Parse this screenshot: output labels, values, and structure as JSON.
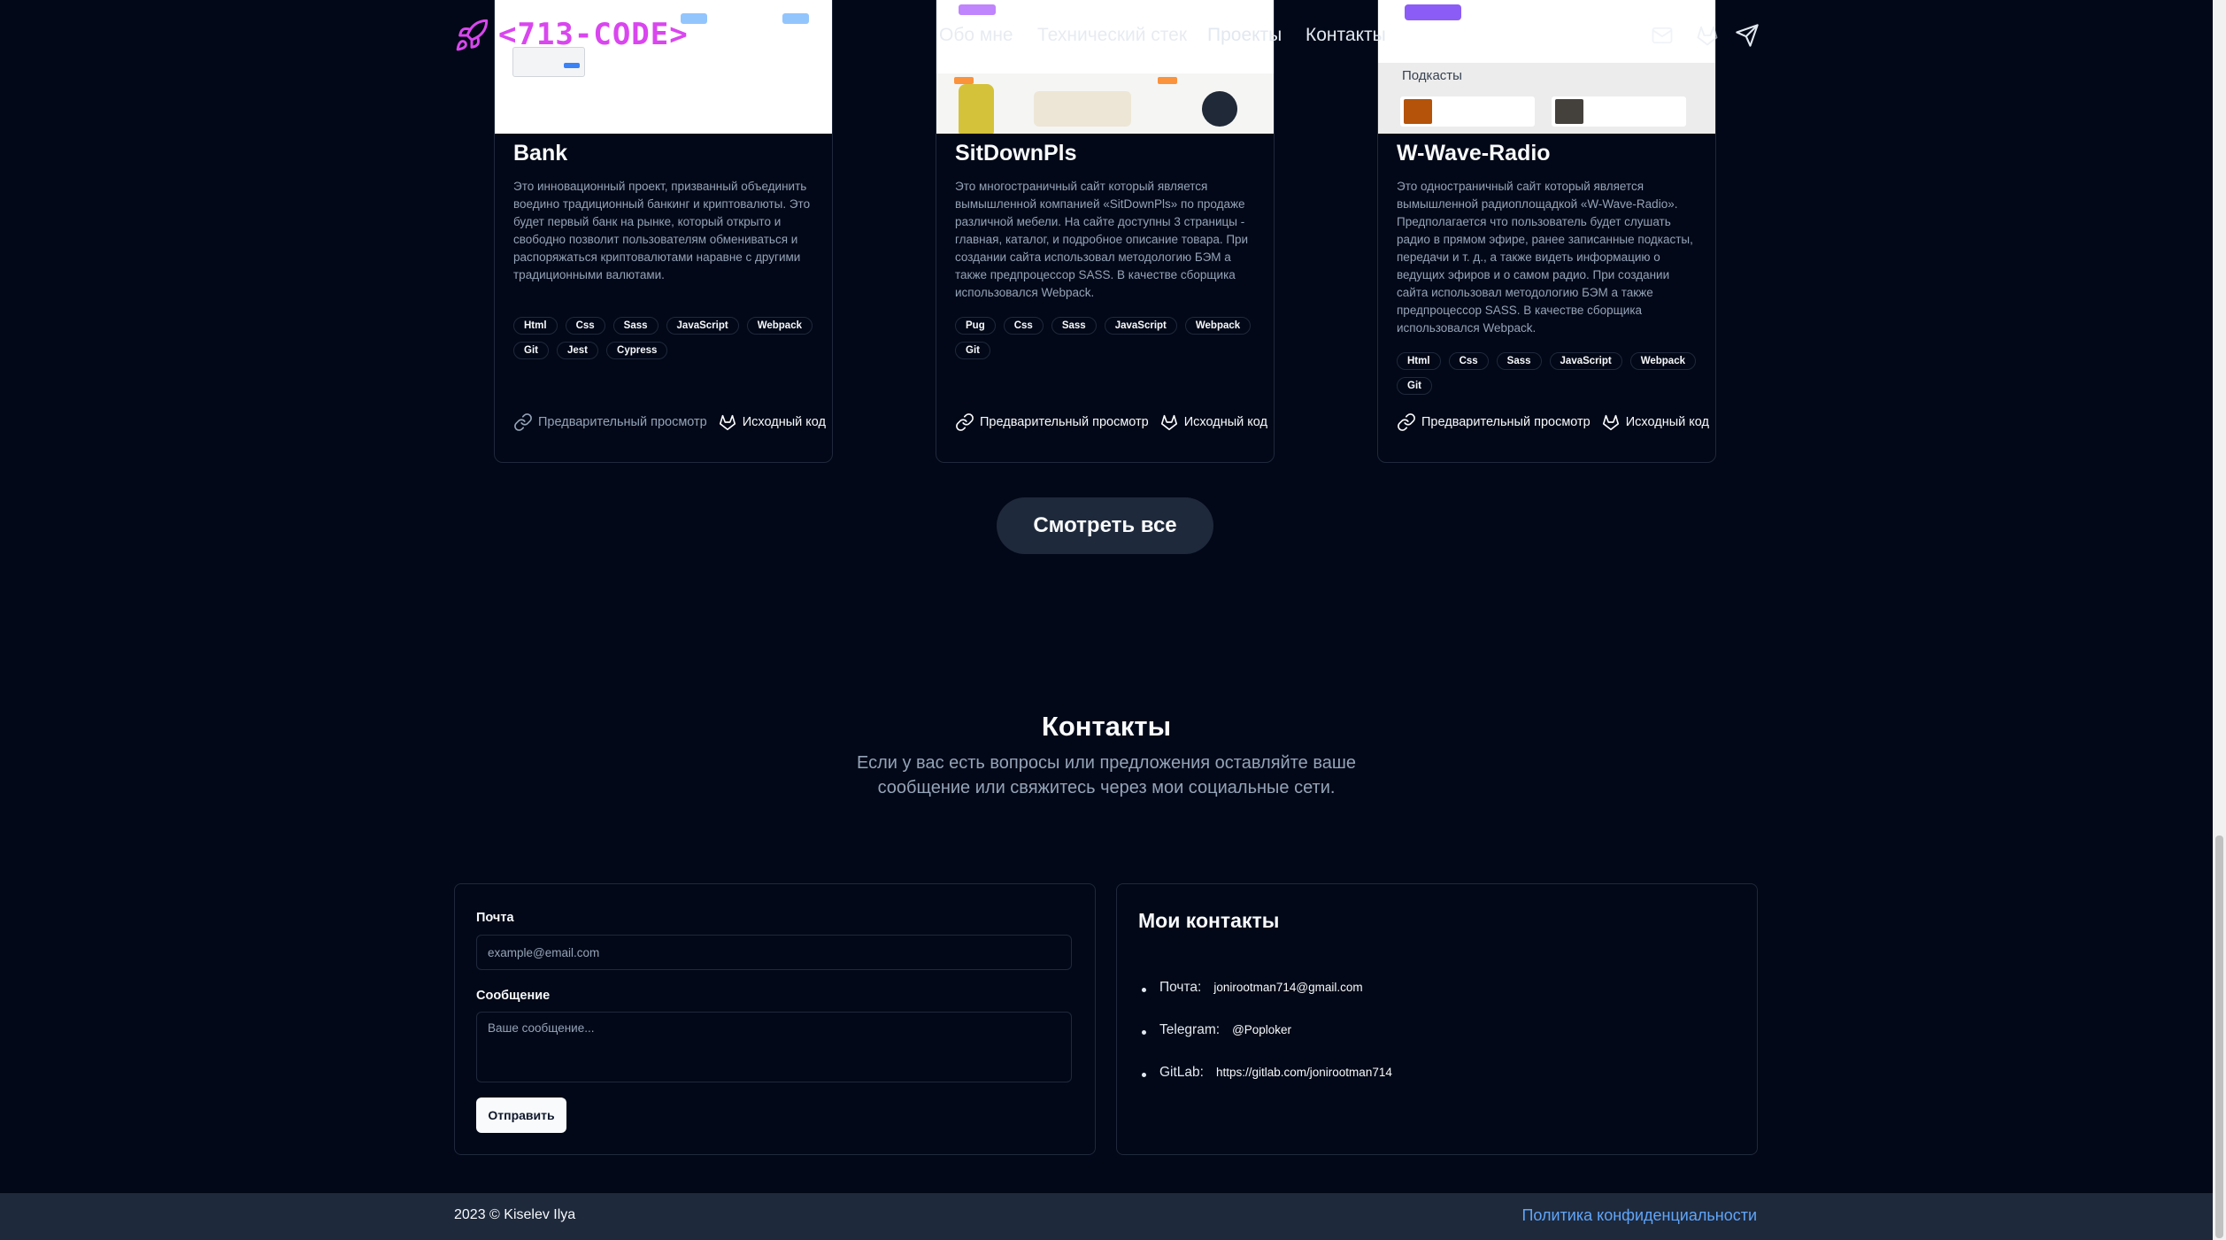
{
  "header": {
    "logo_text": "<713-CODE>",
    "nav": [
      "Обо мне",
      "Технический стек",
      "Проекты",
      "Контакты"
    ]
  },
  "projects": [
    {
      "title": "Bank",
      "description": "Это инновационный проект, призванный объединить воедино традиционный банкинг и криптовалюты. Это будет первый банк на рынке, который открыто и свободно позволит пользователям обмениваться и распоряжаться криптовалютами наравне с другими традиционными валютами.",
      "tags": [
        "Html",
        "Css",
        "Sass",
        "JavaScript",
        "Webpack",
        "Git",
        "Jest",
        "Cypress"
      ],
      "preview_label": "Предварительный просмотр",
      "source_label": "Исходный код"
    },
    {
      "title": "SitDownPls",
      "description": "Это многостраничный сайт который является вымышленной компанией «SitDownPls» по продаже различной мебели. На сайте доступны 3 страницы - главная, каталог, и подробное описание товара. При создании сайта использовал методологию БЭМ а также предпроцессор SASS. В качестве сборщика использовался Webpack.",
      "tags": [
        "Pug",
        "Css",
        "Sass",
        "JavaScript",
        "Webpack",
        "Git"
      ],
      "preview_label": "Предварительный просмотр",
      "source_label": "Исходный код"
    },
    {
      "title": "W-Wave-Radio",
      "description": "Это одностраничный сайт который является вымышленной радиоплощадкой «W-Wave-Radio». Предполагается что пользователь будет слушать радио в прямом эфире, ранее записанные подкасты, передачи и т. д., а также видеть информацию о ведущих эфиров и о самом радио. При создании сайта использовал методологию БЭМ а также предпроцессор SASS. В качестве сборщика использовался Webpack.",
      "tags": [
        "Html",
        "Css",
        "Sass",
        "JavaScript",
        "Webpack",
        "Git"
      ],
      "preview_label": "Предварительный просмотр",
      "source_label": "Исходный код",
      "thumb_label": "Подкасты"
    }
  ],
  "see_all": "Смотреть все",
  "contacts": {
    "title": "Контакты",
    "subtitle": "Если у вас есть вопросы или предложения оставляйте ваше сообщение или свяжитесь через мои социальные сети.",
    "form": {
      "email_label": "Почта",
      "email_placeholder": "example@email.com",
      "message_label": "Сообщение",
      "message_placeholder": "Ваше сообщение...",
      "submit": "Отправить"
    },
    "my_contacts": {
      "title": "Мои контакты",
      "items": [
        {
          "key": "Почта:",
          "value": "jonirootman714@gmail.com"
        },
        {
          "key": "Telegram:",
          "value": "@Poploker"
        },
        {
          "key": "GitLab:",
          "value": "https://gitlab.com/jonirootman714"
        }
      ]
    }
  },
  "footer": {
    "copyright": "2023 © Kiselev Ilya",
    "policy": "Политика конфиденциальности"
  },
  "colors": {
    "background": "#020817",
    "logo": "#d946ef",
    "link": "#60a5fa",
    "border": "#1e293b"
  },
  "icons": [
    "rocket-icon",
    "link-icon",
    "gitlab-icon",
    "mail-icon",
    "telegram-icon"
  ]
}
